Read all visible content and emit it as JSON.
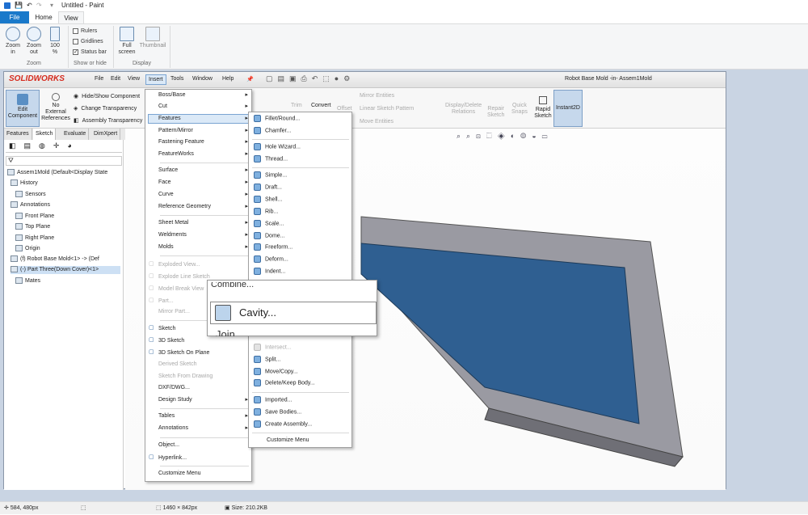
{
  "paint": {
    "title": "Untitled - Paint",
    "tabs": {
      "file": "File",
      "home": "Home",
      "view": "View"
    },
    "ribbon": {
      "zoom_in": [
        "Zoom",
        "in"
      ],
      "zoom_out": [
        "Zoom",
        "out"
      ],
      "hundred": [
        "100",
        "%"
      ],
      "zoom_group": "Zoom",
      "rulers": "Rulers",
      "gridlines": "Gridlines",
      "status_bar": "Status bar",
      "show_group": "Show or hide",
      "full_screen": [
        "Full",
        "screen"
      ],
      "thumbnail": "Thumbnail",
      "display_group": "Display"
    },
    "status": {
      "cursor": "584, 480px",
      "dims": "1460 × 842px",
      "size": "Size: 210.2KB"
    }
  },
  "sw": {
    "logo": "SOLIDWORKS",
    "menus": [
      "File",
      "Edit",
      "View",
      "Insert",
      "Tools",
      "Window",
      "Help"
    ],
    "doc_title": "Robot Base Mold -in- Assem1Mold",
    "cmd": {
      "edit_component": [
        "Edit",
        "Component"
      ],
      "no_external": [
        "No",
        "External",
        "References"
      ],
      "hide_show": "Hide/Show Component",
      "change_transparency": "Change Transparency",
      "assembly_transparency": "Assembly Transparency",
      "trim": "Trim",
      "convert": "Convert",
      "offset": "Offset",
      "mirror_entities": "Mirror Entities",
      "linear_sketch_pattern": "Linear Sketch Pattern",
      "move_entities": "Move Entities",
      "display_delete": [
        "Display/Delete",
        "Relations"
      ],
      "repair_sketch": [
        "Repair",
        "Sketch"
      ],
      "quick_snaps": [
        "Quick",
        "Snaps"
      ],
      "rapid_sketch": [
        "Rapid",
        "Sketch"
      ],
      "instant2d": "Instant2D"
    },
    "tabs": [
      "Features",
      "Sketch",
      "Evaluate",
      "DimXpert"
    ],
    "tree": [
      "Assem1Mold  (Default<Display State",
      "History",
      "Sensors",
      "Annotations",
      "Front Plane",
      "Top Plane",
      "Right Plane",
      "Origin",
      "(f) Robot Base Mold<1> -> (Def",
      "(-) Part Three(Down Cover)<1>",
      "Mates"
    ]
  },
  "insert_menu": [
    {
      "label": "Boss/Base",
      "arrow": true
    },
    {
      "label": "Cut",
      "arrow": true
    },
    {
      "label": "Features",
      "arrow": true
    },
    {
      "label": "Pattern/Mirror",
      "arrow": true
    },
    {
      "label": "Fastening Feature",
      "arrow": true
    },
    {
      "label": "FeatureWorks",
      "arrow": true
    },
    {
      "label": "Surface",
      "arrow": true
    },
    {
      "label": "Face",
      "arrow": true
    },
    {
      "label": "Curve",
      "arrow": true
    },
    {
      "label": "Reference Geometry",
      "arrow": true
    },
    {
      "label": "Sheet Metal",
      "arrow": true
    },
    {
      "label": "Weldments",
      "arrow": true
    },
    {
      "label": "Molds",
      "arrow": true
    },
    {
      "label": "Exploded View...",
      "disabled": true
    },
    {
      "label": "Explode Line Sketch",
      "disabled": true
    },
    {
      "label": "Model Break View",
      "disabled": true
    },
    {
      "label": "Part...",
      "disabled": true
    },
    {
      "label": "Mirror Part...",
      "disabled": true
    },
    {
      "label": "Sketch"
    },
    {
      "label": "3D Sketch"
    },
    {
      "label": "3D Sketch On Plane"
    },
    {
      "label": "Derived Sketch",
      "disabled": true
    },
    {
      "label": "Sketch From Drawing",
      "disabled": true
    },
    {
      "label": "DXF/DWG..."
    },
    {
      "label": "Design Study",
      "arrow": true
    },
    {
      "label": "Tables",
      "arrow": true
    },
    {
      "label": "Annotations",
      "arrow": true
    },
    {
      "label": "Object..."
    },
    {
      "label": "Hyperlink..."
    },
    {
      "label": "Customize Menu"
    }
  ],
  "features_menu": [
    "Fillet/Round...",
    "Chamfer...",
    "Hole Wizard...",
    "Thread...",
    "Simple...",
    "Draft...",
    "Shell...",
    "Rib...",
    "Scale...",
    "Dome...",
    "Freeform...",
    "Deform...",
    "Indent...",
    "Intersect...",
    "Split...",
    "Move/Copy...",
    "Delete/Keep Body...",
    "Imported...",
    "Save Bodies...",
    "Create Assembly...",
    "Customize Menu"
  ],
  "popup": {
    "cavity": "Cavity...",
    "partial_top": "Combine...",
    "partial_bottom": "Join..."
  }
}
